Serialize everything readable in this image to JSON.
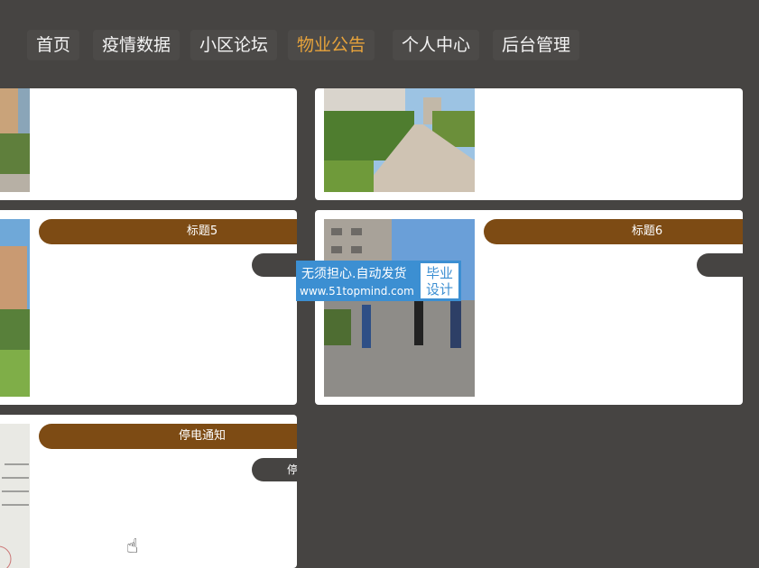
{
  "nav": {
    "items": [
      {
        "label": "首页"
      },
      {
        "label": "疫情数据"
      },
      {
        "label": "小区论坛"
      },
      {
        "label": "物业公告"
      },
      {
        "label": "个人中心"
      },
      {
        "label": "后台管理"
      }
    ],
    "active_index": 3
  },
  "cards": [
    {
      "title": "标题5",
      "subtitle": ""
    },
    {
      "title": "标题6",
      "subtitle": ""
    },
    {
      "title": "停电通知",
      "subtitle": "停电通知"
    }
  ],
  "watermark": {
    "line1": "无须担心.自动发货",
    "line2": "www.51topmind.com",
    "box": "毕业设计"
  },
  "colors": {
    "background": "#464442",
    "accent": "#e7a33b",
    "title_pill": "#7d4b14",
    "watermark": "#3c8fd2"
  }
}
